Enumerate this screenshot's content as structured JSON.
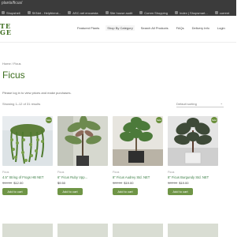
{
  "browser": {
    "url": "plants/ficus/",
    "bookmarks": [
      "Shopshell",
      "SKNet - Helpfriend...",
      "ASC.net encuesta",
      "Site house audit",
      "Comm Shopping",
      "Index | Shopsmart...",
      "current"
    ]
  },
  "header": {
    "logo_line1": "TE",
    "logo_line2": "GE",
    "nav": [
      "Featured Plants",
      "Shop By Category",
      "Search All Products",
      "FAQs",
      "Delivery Info",
      "Login"
    ]
  },
  "breadcrumb": "Home / Ficus",
  "page_title": "Ficus",
  "login_message": "Please log in to view prices and make purchases.",
  "result_count": "Showing 1–12 of 31 results",
  "sort": {
    "selected": "Default sorting",
    "chevron_icon": "chevron-down-icon"
  },
  "sale_badge": "Sale!",
  "products": [
    {
      "category": "Ficus",
      "name": "4.5\" String of Frogs HB NET",
      "old_price": "$14.00",
      "new_price": "$12.00",
      "button": "Add to cart"
    },
    {
      "category": "Ficus",
      "name": "6\" Ficus Ruby Vpp...",
      "old_price": "",
      "new_price": "$9.50",
      "button": "Add to cart"
    },
    {
      "category": "Ficus",
      "name": "8\" Ficus Audrey Std. NET",
      "old_price": "$22.00",
      "new_price": "$19.00",
      "button": "Add to cart"
    },
    {
      "category": "Ficus",
      "name": "8\" Ficus Burgundy Std. NET",
      "old_price": "$22.00",
      "new_price": "$19.00",
      "button": "Add to cart"
    }
  ],
  "colors": {
    "brand_green": "#3d6e1f",
    "button_green": "#6f9546"
  }
}
